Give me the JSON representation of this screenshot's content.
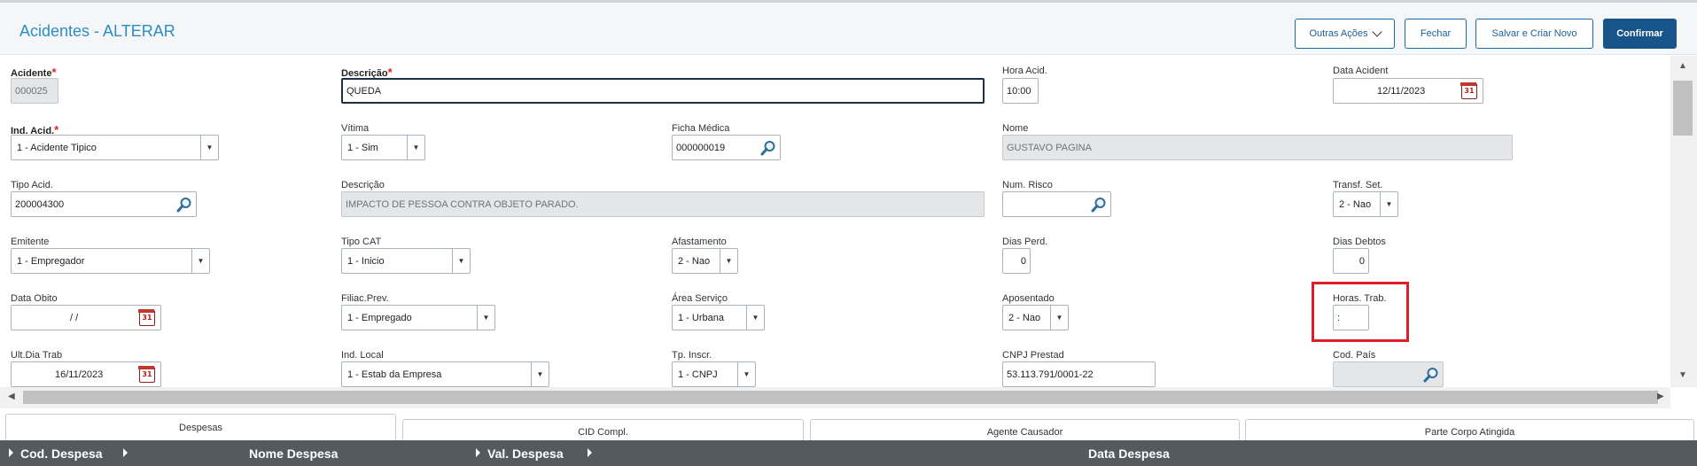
{
  "header": {
    "title": "Acidentes - ALTERAR",
    "buttons": {
      "other_actions": "Outras Ações",
      "close": "Fechar",
      "save_new": "Salvar e Criar Novo",
      "confirm": "Confirmar"
    }
  },
  "form": {
    "acidente": {
      "label": "Acidente",
      "value": "000025"
    },
    "descricao": {
      "label": "Descrição",
      "value": "QUEDA"
    },
    "hora_acid": {
      "label": "Hora Acid.",
      "value": "10:00"
    },
    "data_acident": {
      "label": "Data Acident",
      "value": "12/11/2023"
    },
    "ind_acid": {
      "label": "Ind. Acid.",
      "value": "1 - Acidente Tipico"
    },
    "vitima": {
      "label": "Vítima",
      "value": "1 - Sim"
    },
    "ficha_medica": {
      "label": "Ficha Médica",
      "value": "000000019"
    },
    "nome": {
      "label": "Nome",
      "value": "GUSTAVO PAGINA"
    },
    "tipo_acid": {
      "label": "Tipo Acid.",
      "value": "200004300"
    },
    "descricao2": {
      "label": "Descrição",
      "value": "IMPACTO DE PESSOA CONTRA OBJETO PARADO."
    },
    "num_risco": {
      "label": "Num. Risco",
      "value": ""
    },
    "transf_set": {
      "label": "Transf. Set.",
      "value": "2 - Nao"
    },
    "emitente": {
      "label": "Emitente",
      "value": "1 - Empregador"
    },
    "tipo_cat": {
      "label": "Tipo CAT",
      "value": "1 - Inicio"
    },
    "afastamento": {
      "label": "Afastamento",
      "value": "2 - Nao"
    },
    "dias_perd": {
      "label": "Dias Perd.",
      "value": "0"
    },
    "dias_debtos": {
      "label": "Dias Debtos",
      "value": "0"
    },
    "data_obito": {
      "label": "Data Obito",
      "value": "/ /"
    },
    "filiac_prev": {
      "label": "Filiac.Prev.",
      "value": "1 - Empregado"
    },
    "area_servico": {
      "label": "Área Serviço",
      "value": "1 - Urbana"
    },
    "aposentado": {
      "label": "Aposentado",
      "value": "2 - Nao"
    },
    "horas_trab": {
      "label": "Horas. Trab.",
      "value": ":"
    },
    "ult_dia_trab": {
      "label": "Ult.Dia Trab",
      "value": "16/11/2023"
    },
    "ind_local": {
      "label": "Ind. Local",
      "value": "1 - Estab da Empresa"
    },
    "tp_inscr": {
      "label": "Tp. Inscr.",
      "value": "1 - CNPJ"
    },
    "cnpj_prestad": {
      "label": "CNPJ Prestad",
      "value": "53.113.791/0001-22"
    },
    "cod_pais": {
      "label": "Cod. País",
      "value": ""
    }
  },
  "tabs": [
    "Despesas",
    "CID Compl.",
    "Agente Causador",
    "Parte Corpo Atingida"
  ],
  "grid": {
    "columns": [
      "Cod. Despesa",
      "Nome Despesa",
      "Val. Despesa",
      "Data Despesa"
    ]
  },
  "colors": {
    "title": "#2d8ec4",
    "primary_button": "#16548a",
    "required_star": "#e02020",
    "highlight_box": "#e01e2a",
    "grid_header": "#555a5f"
  },
  "icons": {
    "search": "magnifier-icon",
    "calendar": "calendar-icon",
    "dropdown": "chevron-down-icon"
  }
}
